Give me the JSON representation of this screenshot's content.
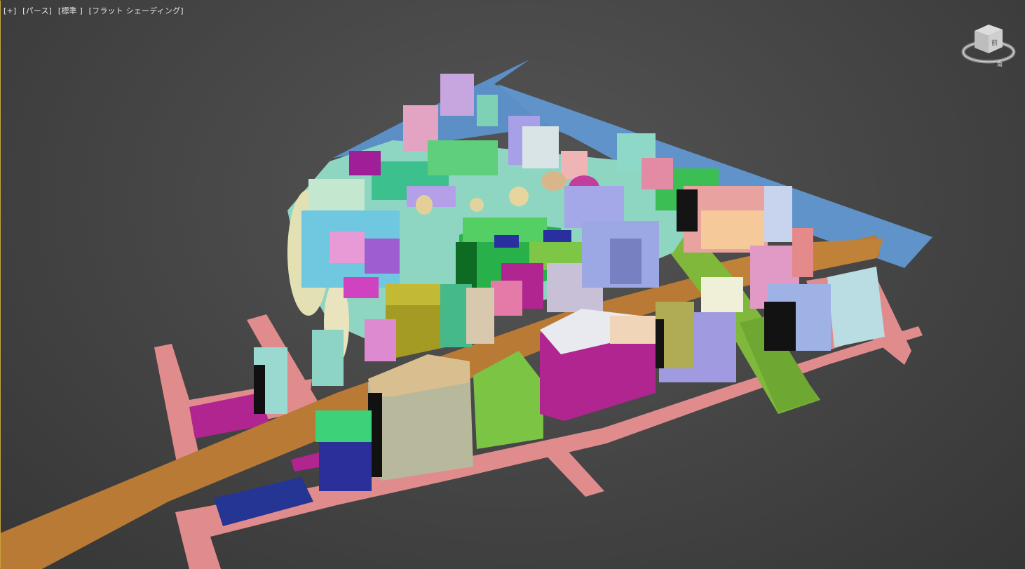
{
  "viewport": {
    "labels": {
      "plus": "[+]",
      "view": "[パース]",
      "camera": "[標準 ]",
      "shading": "[フラット シェーディング]"
    }
  },
  "viewcube": {
    "face_label": "前",
    "compass_label": "南"
  },
  "colors": {
    "background": "#474747",
    "water": "#5b8fc6",
    "main_road": "#b87a34",
    "sidewalk": "#e08c8c",
    "magenta_block": "#b0258f",
    "navy_block": "#243593",
    "green_block": "#6abf3a",
    "lime_road": "#7fb83a",
    "beige_building": "#b8b89c",
    "navy_building": "#2b2f9a"
  }
}
